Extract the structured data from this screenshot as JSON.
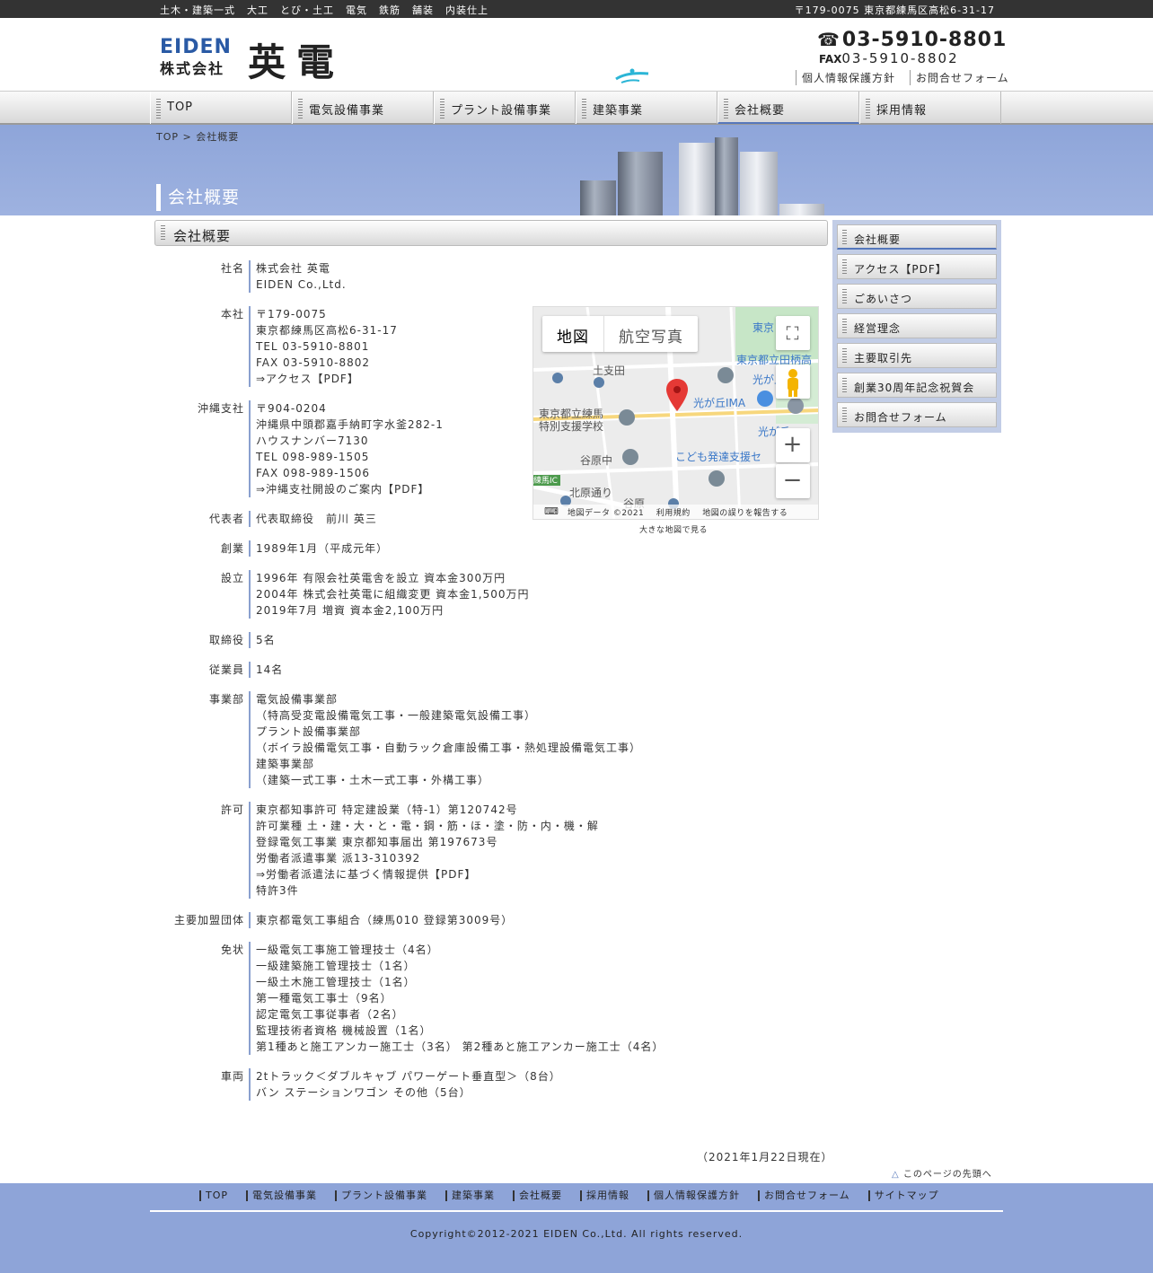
{
  "topbar": {
    "services": [
      "土木・建築一式",
      "大工",
      "とび・土工",
      "電気",
      "鉄筋",
      "舗装",
      "内装仕上"
    ],
    "address": "〒179-0075 東京都練馬区高松6-31-17"
  },
  "header": {
    "logo_en": "EIDEN",
    "logo_kk": "株式会社",
    "logo_jp": "英電",
    "tel": "03-5910-8801",
    "fax_label": "FAX",
    "fax": "03-5910-8802",
    "links": [
      "個人情報保護方針",
      "お問合せフォーム"
    ]
  },
  "gnav": [
    "TOP",
    "電気設備事業",
    "プラント設備事業",
    "建築事業",
    "会社概要",
    "採用情報"
  ],
  "banner": {
    "breadcrumb": "TOP > 会社概要",
    "title": "会社概要"
  },
  "main": {
    "heading": "会社概要",
    "rows": [
      {
        "label": "社名",
        "lines": [
          "株式会社 英電",
          "EIDEN Co.,Ltd."
        ]
      },
      {
        "label": "本社",
        "lines": [
          "〒179-0075",
          "東京都練馬区高松6-31-17",
          "TEL 03-5910-8801",
          "FAX 03-5910-8802",
          "⇒アクセス【PDF】"
        ]
      },
      {
        "label": "沖縄支社",
        "lines": [
          "〒904-0204",
          "沖縄県中頭郡嘉手納町字水釜282-1",
          "ハウスナンバー7130",
          "TEL 098-989-1505",
          "FAX 098-989-1506",
          "⇒沖縄支社開設のご案内【PDF】"
        ]
      },
      {
        "label": "代表者",
        "lines": [
          "代表取締役　前川 英三"
        ]
      },
      {
        "label": "創業",
        "lines": [
          "1989年1月（平成元年）"
        ]
      },
      {
        "label": "設立",
        "lines": [
          "1996年 有限会社英電舎を設立 資本金300万円",
          "2004年 株式会社英電に組織変更 資本金1,500万円",
          "2019年7月 増資 資本金2,100万円"
        ]
      },
      {
        "label": "取締役",
        "lines": [
          "5名"
        ]
      },
      {
        "label": "従業員",
        "lines": [
          "14名"
        ]
      },
      {
        "label": "事業部",
        "lines": [
          "電気設備事業部",
          "（特高受変電設備電気工事・一般建築電気設備工事）",
          "プラント設備事業部",
          "（ボイラ設備電気工事・自動ラック倉庫設備工事・熱処理設備電気工事）",
          "建築事業部",
          "（建築一式工事・土木一式工事・外構工事）"
        ]
      },
      {
        "label": "許可",
        "lines": [
          "東京都知事許可 特定建設業（特-1）第120742号",
          "許可業種 土・建・大・と・電・鋼・筋・ほ・塗・防・内・機・解",
          "登録電気工事業 東京都知事届出 第197673号",
          "労働者派遣事業 派13-310392",
          "⇒労働者派遣法に基づく情報提供【PDF】",
          "特許3件"
        ]
      },
      {
        "label": "主要加盟団体",
        "lines": [
          "東京都電気工事組合（練馬010 登録第3009号）"
        ]
      },
      {
        "label": "免状",
        "lines": [
          "一級電気工事施工管理技士（4名）",
          "一級建築施工管理技士（1名）",
          "一級土木施工管理技士（1名）",
          "第一種電気工事士（9名）",
          "認定電気工事従事者（2名）",
          "監理技術者資格 機械設置（1名）",
          "第1種あと施工アンカー施工士（3名） 第2種あと施工アンカー施工士（4名）"
        ]
      },
      {
        "label": "車両",
        "lines": [
          "2tトラック＜ダブルキャブ パワーゲート垂直型＞（8台）",
          "バン ステーションワゴン その他（5台）"
        ]
      }
    ],
    "as_of": "（2021年1月22日現在）",
    "to_top": "このページの先頭へ"
  },
  "map": {
    "tab_map": "地図",
    "tab_satellite": "航空写真",
    "labels": [
      "土支田",
      "光が丘IMA",
      "東京都立練馬",
      "特別支援学校",
      "谷原中",
      "こども発達支援セ",
      "北原通り",
      "谷原",
      "練馬IC",
      "東京都立田柄高",
      "光が丘",
      "東京",
      "光が丘"
    ],
    "credit_data": "地図データ ©2021",
    "credit_terms": "利用規約",
    "credit_report": "地図の誤りを報告する",
    "large_link": "大きな地図で見る"
  },
  "side": [
    "会社概要",
    "アクセス【PDF】",
    "ごあいさつ",
    "経営理念",
    "主要取引先",
    "創業30周年記念祝賀会",
    "お問合せフォーム"
  ],
  "footer": {
    "links": [
      "TOP",
      "電気設備事業",
      "プラント設備事業",
      "建築事業",
      "会社概要",
      "採用情報",
      "個人情報保護方針",
      "お問合せフォーム",
      "サイトマップ"
    ],
    "copyright": "Copyright©2012-2021 EIDEN Co.,Ltd. All rights reserved."
  },
  "colors": {
    "accent": "#8ea4d8",
    "nav_active": "#5577bb",
    "map_pin": "#e53935"
  }
}
